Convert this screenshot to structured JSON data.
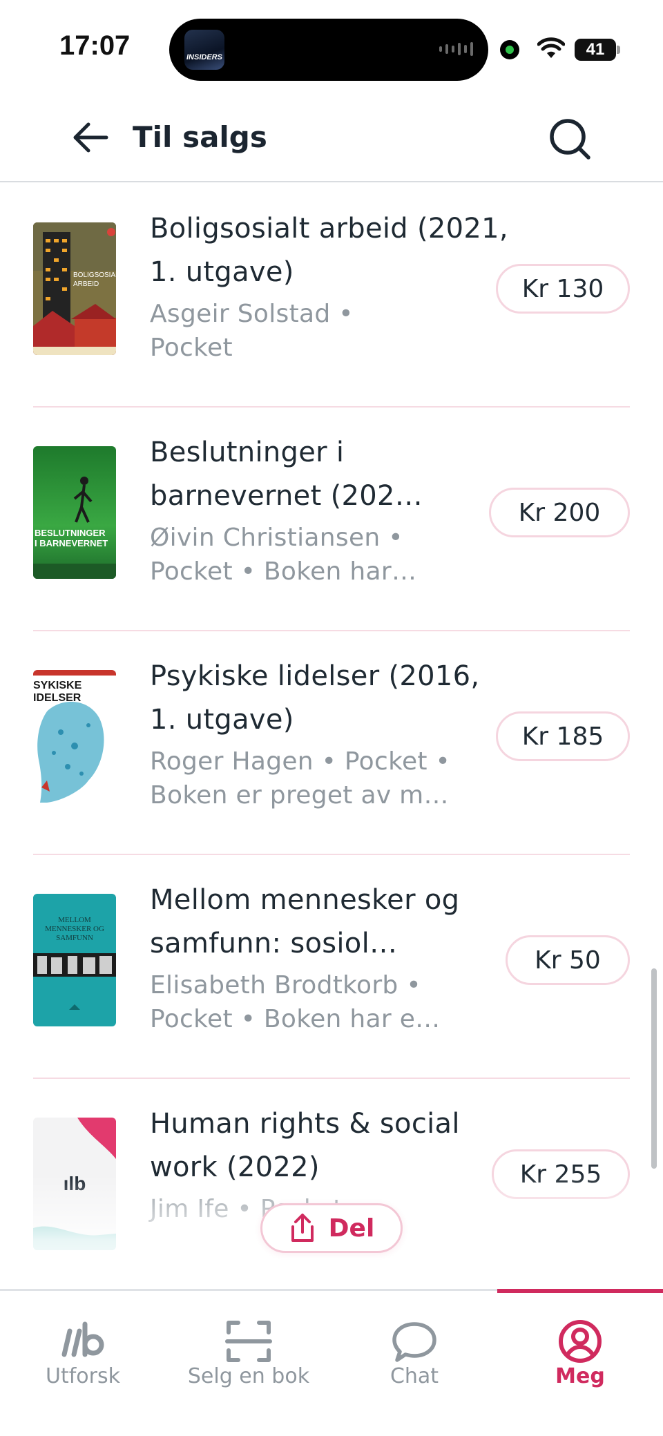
{
  "status_bar": {
    "time": "17:07",
    "island_art_text": "INSIDERS",
    "battery": "41"
  },
  "header": {
    "title": "Til salgs",
    "back_icon": "arrow-left-icon",
    "search_icon": "search-icon"
  },
  "listings": [
    {
      "title": "Boligsosialt arbeid (2021, 1. utgave)",
      "meta": "Asgeir Solstad •\nPocket",
      "price": "Kr 130",
      "cover_text": "BOLIGSOSIALT\nARBEID"
    },
    {
      "title": "Beslutninger i barnevernet (202…",
      "meta": "Øivin Christiansen •\nPocket • Boken har…",
      "price": "Kr 200",
      "cover_text": "BESLUTNINGER\nI BARNEVERNET"
    },
    {
      "title": "Psykiske lidelser (2016, 1. utgave)",
      "meta": "Roger Hagen • Pocket •\nBoken er preget av m…",
      "price": "Kr 185",
      "cover_text": "SYKISKE\nIDELSER"
    },
    {
      "title": "Mellom mennesker og samfunn: sosiol…",
      "meta": "Elisabeth Brodtkorb •\nPocket • Boken har e…",
      "price": "Kr 50",
      "cover_text": "MELLOM\nMENNESKER OG\nSAMFUNN"
    },
    {
      "title": "Human rights & social work (2022)",
      "meta": "Jim Ife • Pocket",
      "price": "Kr 255",
      "cover_text": "ılb"
    }
  ],
  "share": {
    "label": "Del",
    "icon": "share-icon"
  },
  "tabbar": {
    "tabs": [
      {
        "label": "Utforsk",
        "icon": "logo-icon"
      },
      {
        "label": "Selg en bok",
        "icon": "scan-icon"
      },
      {
        "label": "Chat",
        "icon": "chat-bubble-icon"
      },
      {
        "label": "Meg",
        "icon": "profile-icon"
      }
    ],
    "active_index": 3
  },
  "colors": {
    "accent": "#d02a5e",
    "text": "#1f2a33",
    "muted": "#8f979e",
    "divider": "#f6dbe3"
  }
}
